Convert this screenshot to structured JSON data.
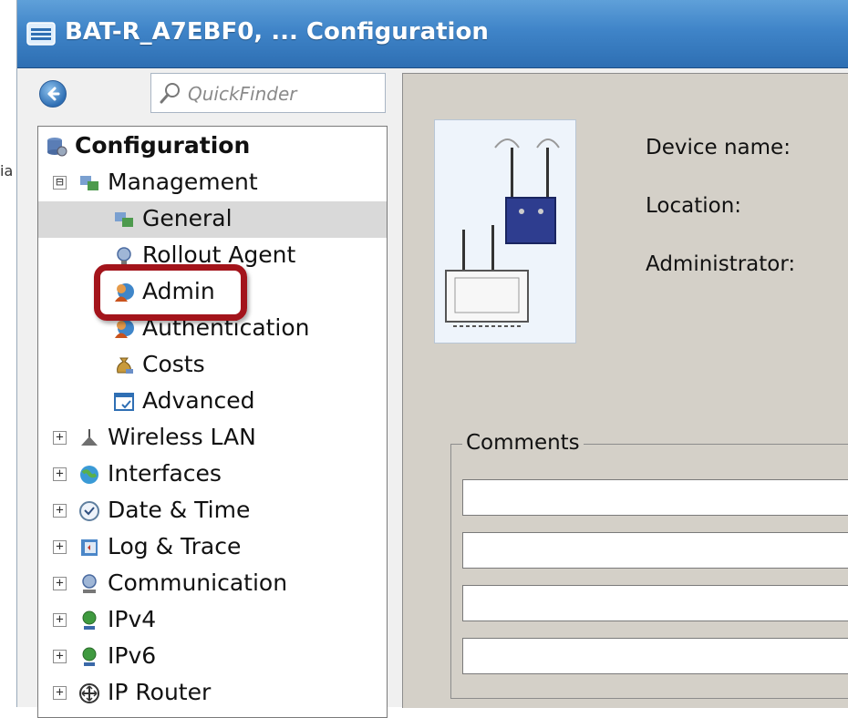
{
  "outside": {
    "hint": "ia"
  },
  "window": {
    "title": "BAT-R_A7EBF0, ... Configuration"
  },
  "nav": {
    "back_icon": "back-arrow-icon"
  },
  "search": {
    "placeholder": "QuickFinder",
    "value": ""
  },
  "tree": {
    "root": {
      "label": "Configuration",
      "icon": "database-config-icon"
    },
    "management": {
      "label": "Management",
      "expander": "⊟",
      "icon": "network-management-icon",
      "children": [
        {
          "label": "General",
          "icon": "general-network-icon",
          "selected": true
        },
        {
          "label": "Rollout Agent",
          "icon": "globe-agent-icon"
        },
        {
          "label": "Admin",
          "icon": "admin-user-icon"
        },
        {
          "label": "Authentication",
          "icon": "users-auth-icon"
        },
        {
          "label": "Costs",
          "icon": "money-bag-icon"
        },
        {
          "label": "Advanced",
          "icon": "advanced-window-icon"
        }
      ]
    },
    "items": [
      {
        "label": "Wireless LAN",
        "expander": "+",
        "icon": "wireless-antenna-icon"
      },
      {
        "label": "Interfaces",
        "expander": "+",
        "icon": "interfaces-globe-icon"
      },
      {
        "label": "Date & Time",
        "expander": "+",
        "icon": "clock-icon"
      },
      {
        "label": "Log & Trace",
        "expander": "+",
        "icon": "log-book-icon"
      },
      {
        "label": "Communication",
        "expander": "+",
        "icon": "communication-globe-icon"
      },
      {
        "label": "IPv4",
        "expander": "+",
        "icon": "ipv4-globe-icon"
      },
      {
        "label": "IPv6",
        "expander": "+",
        "icon": "ipv6-globe-icon"
      },
      {
        "label": "IP Router",
        "expander": "+",
        "icon": "router-icon"
      }
    ]
  },
  "general": {
    "device_name_label": "Device name:",
    "location_label": "Location:",
    "administrator_label": "Administrator:",
    "comments_label": "Comments",
    "comment_values": [
      "",
      "",
      "",
      ""
    ]
  },
  "colors": {
    "title_bar": "#3f84c8",
    "highlight": "#a3141b",
    "selected_row": "#d9d9d9",
    "panel_bg": "#d4d0c8"
  }
}
